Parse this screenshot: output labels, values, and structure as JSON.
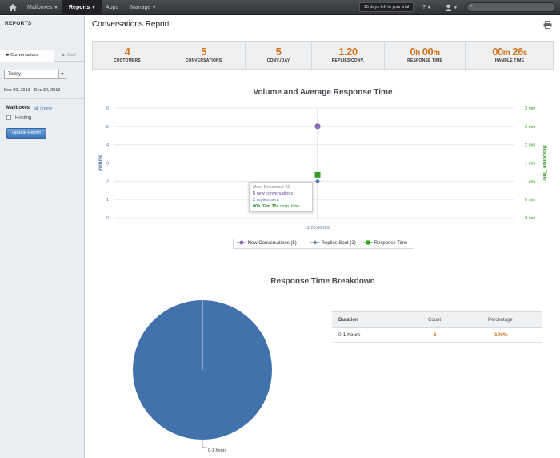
{
  "topnav": {
    "items": [
      {
        "label": "Mailboxes",
        "has_caret": true
      },
      {
        "label": "Reports",
        "has_caret": true,
        "active": true
      },
      {
        "label": "Apps",
        "has_caret": false
      },
      {
        "label": "Manage",
        "has_caret": true
      }
    ],
    "trial_text": "15 days left in your trial",
    "help_label": "?"
  },
  "sidebar": {
    "title": "REPORTS",
    "tabs": [
      "Conversations",
      "Staff"
    ],
    "date_select": "Today",
    "date_range": "Dec 30, 2013 - Dec 30, 2013",
    "mailboxes_title": "Mailboxes",
    "mailboxes_links": {
      "all": "all",
      "sep": "/",
      "none": "none"
    },
    "mailboxes": [
      {
        "label": "Hosting",
        "checked": false
      }
    ],
    "update_button": "Update Report"
  },
  "main": {
    "title": "Conversations Report",
    "stats": [
      {
        "value": "4",
        "label": "CUSTOMERS"
      },
      {
        "value": "5",
        "label": "CONVERSATIONS"
      },
      {
        "value": "5",
        "label": "CONV./DAY"
      },
      {
        "value": "1.20",
        "label": "REPLIES/CONV."
      },
      {
        "value_parts": [
          "0",
          "h",
          " 00",
          "m"
        ],
        "label": "RESPONSE TIME"
      },
      {
        "value_parts": [
          "00",
          "m",
          " 26",
          "s"
        ],
        "label": "HANDLE TIME"
      }
    ]
  },
  "chart_data": [
    {
      "type": "line",
      "title": "Volume and Average Response Time",
      "ylabel": "Volume",
      "y2label": "Response Time",
      "ylim": [
        0,
        6
      ],
      "y_ticks": [
        "0",
        "1",
        "2",
        "3",
        "4",
        "5",
        "6"
      ],
      "y2_ticks": [
        "0 min",
        "0 min",
        "1 min",
        "1 min",
        "2 min",
        "3 min",
        "3 min"
      ],
      "x": [
        "12 00:00.000"
      ],
      "series": [
        {
          "name": "New Conversations (5)",
          "values": [
            5
          ],
          "color": "#8a6bb5",
          "marker": "circle"
        },
        {
          "name": "Replies Sent (2)",
          "values": [
            2
          ],
          "color": "#5b7ba8",
          "marker": "diamond"
        },
        {
          "name": "Response Time",
          "values": [
            2.35
          ],
          "color": "#3a9a2a",
          "marker": "square",
          "axis": "right"
        }
      ],
      "tooltip": {
        "date": "Mon, December 30",
        "conv_count": "5",
        "conv_text": "new conversations",
        "replies_count": "2",
        "replies_text": "replies sent",
        "time_value": "00h 02m 35s",
        "time_text": "resp. time"
      },
      "legend": "bottom",
      "grid": true
    },
    {
      "type": "pie",
      "title": "Response Time Breakdown",
      "categories": [
        "0-1 hours"
      ],
      "values": [
        100
      ],
      "color": "#4272ab"
    }
  ],
  "breakdown_table": {
    "headers": [
      "Duration",
      "Count",
      "Percentage"
    ],
    "rows": [
      [
        "0-1 hours",
        "6",
        "100%"
      ]
    ]
  },
  "colors": {
    "accent": "#d0741e",
    "link": "#4a7ab8",
    "button": "#3f76b8"
  }
}
